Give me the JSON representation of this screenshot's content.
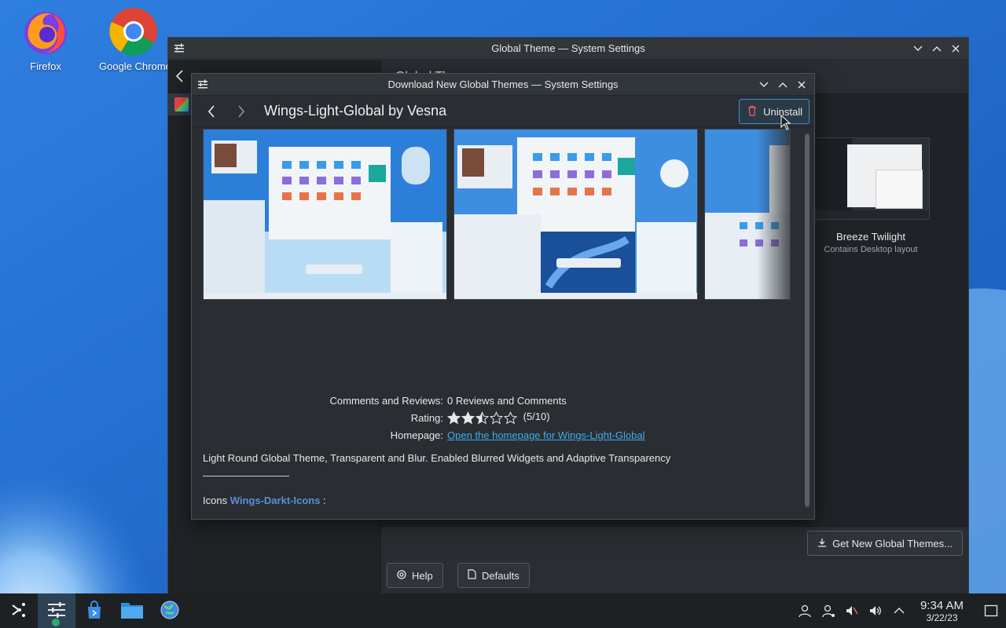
{
  "desktop": {
    "icons": [
      {
        "label": "Firefox"
      },
      {
        "label": "Google Chrome"
      }
    ]
  },
  "back_window": {
    "title": "Global Theme — System Settings",
    "page_title": "Global Theme",
    "theme_card": {
      "name": "Breeze Twilight",
      "desc": "Contains Desktop layout"
    },
    "get_new_label": "Get New Global Themes...",
    "help_label": "Help",
    "defaults_label": "Defaults"
  },
  "dialog": {
    "title": "Download New Global Themes — System Settings",
    "item_title": "Wings-Light-Global by Vesna",
    "uninstall_label": "Uninstall",
    "comments_key": "Comments and Reviews:",
    "comments_value": "0 Reviews and Comments",
    "rating_key": "Rating:",
    "rating_value": "(5/10)",
    "rating_fraction": 0.5,
    "homepage_key": "Homepage:",
    "homepage_link": "Open the homepage for Wings-Light-Global",
    "description": "Light Round Global Theme, Transparent and Blur. Enabled Blurred Widgets and Adaptive Transparency",
    "icons_prefix": "Icons",
    "icons_link": "Wings-Darkt-Icons",
    "icons_suffix": " :"
  },
  "taskbar": {
    "time": "9:34 AM",
    "date": "3/22/23"
  },
  "colors": {
    "accent": "#3daee9",
    "window_bg": "#2a2e32",
    "titlebar_bg": "#31363b",
    "wallpaper": "#1f6fd0"
  }
}
